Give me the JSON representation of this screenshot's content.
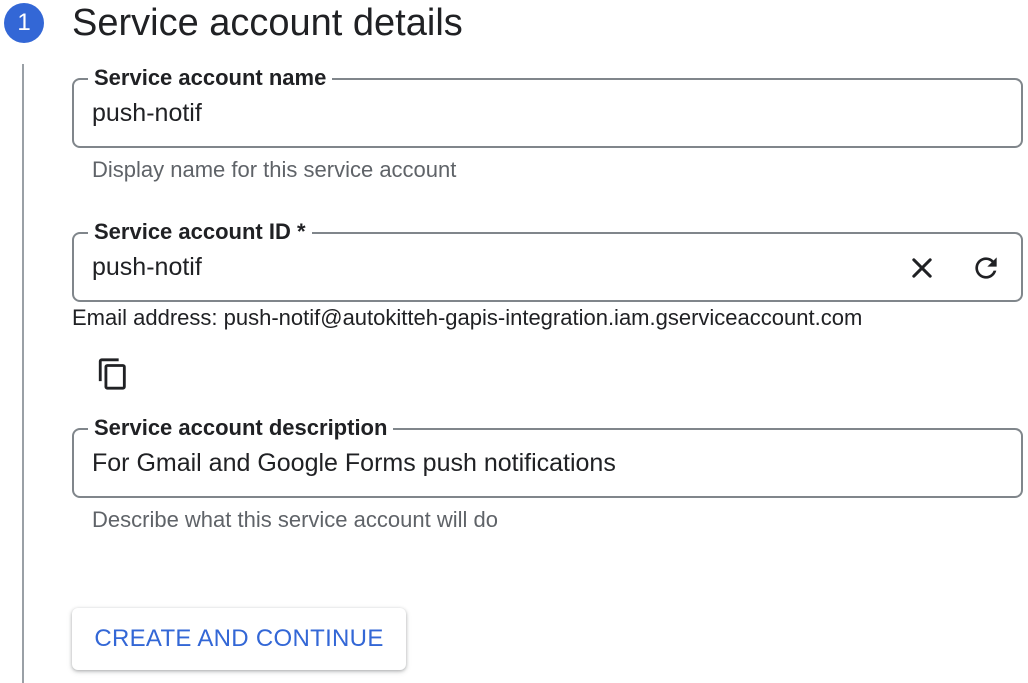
{
  "step": {
    "number": "1",
    "title": "Service account details"
  },
  "name_field": {
    "label": "Service account name",
    "value": "push-notif",
    "hint": "Display name for this service account"
  },
  "id_field": {
    "label": "Service account ID *",
    "value": "push-notif",
    "clear_icon": "close-icon",
    "refresh_icon": "refresh-icon"
  },
  "email": {
    "text": "Email address: push-notif@autokitteh-gapis-integration.iam.gserviceaccount.com",
    "copy_icon": "copy-icon"
  },
  "description_field": {
    "label": "Service account description",
    "value": "For Gmail and Google Forms push notifications",
    "hint": "Describe what this service account will do"
  },
  "actions": {
    "create_label": "CREATE AND CONTINUE"
  },
  "colors": {
    "accent": "#3367d6",
    "border": "#80868b",
    "hint_text": "#5f6368"
  }
}
